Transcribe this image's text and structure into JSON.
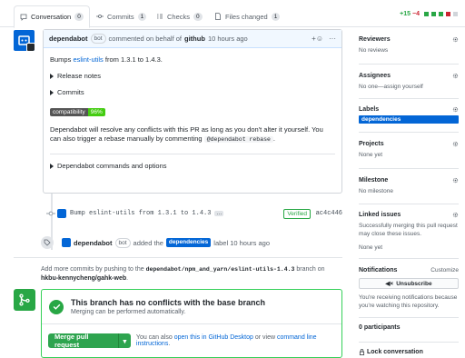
{
  "tabs": [
    {
      "label": "Conversation",
      "count": "0"
    },
    {
      "label": "Commits",
      "count": "1"
    },
    {
      "label": "Checks",
      "count": "0"
    },
    {
      "label": "Files changed",
      "count": "1"
    }
  ],
  "diffstat": {
    "additions": "+15",
    "deletions": "−4"
  },
  "comment": {
    "author": "dependabot",
    "bot_badge": "bot",
    "meta_text": "commented on behalf of",
    "org": "github",
    "time": "10 hours ago",
    "bumps_prefix": "Bumps",
    "package_link": "eslint-utils",
    "bumps_suffix": "from 1.3.1 to 1.4.3.",
    "release_notes": "Release notes",
    "commits": "Commits",
    "compat_label": "compatibility",
    "compat_value": "96%",
    "resolve_text": "Dependabot will resolve any conflicts with this PR as long as you don't alter it yourself. You can also trigger a rebase manually by commenting",
    "rebase_cmd": "@dependabot rebase",
    "resolve_end": ".",
    "commands_options": "Dependabot commands and options"
  },
  "commit": {
    "message": "Bump eslint-utils from 1.3.1 to 1.4.3",
    "verified": "Verified",
    "sha": "ac4c446"
  },
  "label_event": {
    "actor": "dependabot",
    "bot_badge": "bot",
    "text_before": "added the",
    "label": "dependencies",
    "text_after": "label 10 hours ago"
  },
  "add_commits": {
    "prefix": "Add more commits by pushing to the",
    "branch": "dependabot/npm_and_yarn/eslint-utils-1.4.3",
    "middle": "branch on",
    "repo": "hkbu-kennycheng/gahk-web",
    "end": "."
  },
  "merge": {
    "title": "This branch has no conflicts with the base branch",
    "subtitle": "Merging can be performed automatically.",
    "button": "Merge pull request",
    "also_text": "You can also",
    "desktop_link": "open this in GitHub Desktop",
    "or_text": "or view",
    "cli_link": "command line instructions",
    "end": "."
  },
  "sidebar": {
    "reviewers_title": "Reviewers",
    "reviewers_value": "No reviews",
    "assignees_title": "Assignees",
    "assignees_value": "No one—assign yourself",
    "labels_title": "Labels",
    "labels_value": "dependencies",
    "projects_title": "Projects",
    "projects_value": "None yet",
    "milestone_title": "Milestone",
    "milestone_value": "No milestone",
    "linked_title": "Linked issues",
    "linked_desc": "Successfully merging this pull request may close these issues.",
    "linked_value": "None yet",
    "notifications_title": "Notifications",
    "customize": "Customize",
    "unsubscribe": "Unsubscribe",
    "notif_desc": "You're receiving notifications because you're watching this repository.",
    "participants": "0 participants",
    "lock": "Lock conversation"
  },
  "colors": {
    "accent": "#0366d6",
    "green": "#28a745",
    "label_blue": "#0366d6"
  }
}
